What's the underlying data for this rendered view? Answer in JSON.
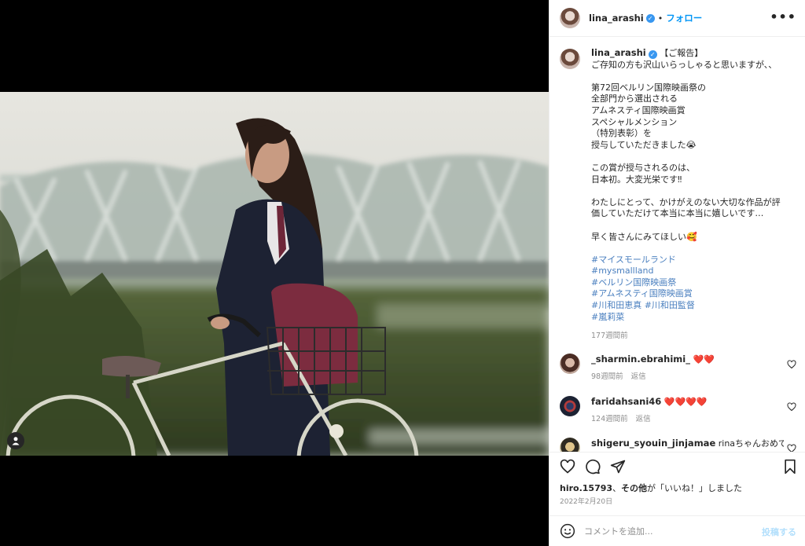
{
  "account": {
    "username": "lina_arashi",
    "verified": true,
    "follow_label": "フォロー"
  },
  "caption": {
    "lines": [
      "【ご報告】",
      "ご存知の方も沢山いらっしゃると思いますが、、",
      "",
      "第72回ベルリン国際映画祭の",
      "全部門から選出される",
      "アムネスティ国際映画賞",
      "スペシャルメンション",
      "（特別表彰）を",
      "授与していただきました😭",
      "",
      "この賞が授与されるのは、",
      "日本初。大変光栄です‼︎",
      "",
      "わたしにとって、かけがえのない大切な作品が評",
      "価していただけて本当に本当に嬉しいです…",
      "",
      "早く皆さんにみてほしい🥰",
      ""
    ],
    "hashtags": [
      [
        "#マイスモールランド"
      ],
      [
        "#mysmallland"
      ],
      [
        "#ベルリン国際映画祭"
      ],
      [
        "#アムネスティ国際映画賞"
      ],
      [
        "#川和田恵真",
        "#川和田監督"
      ],
      [
        "#嵐莉菜"
      ]
    ],
    "time": "177週間前"
  },
  "comments": [
    {
      "username": "_sharmin.ebrahimi_",
      "text": "❤️❤️",
      "time": "98週間前",
      "reply_label": "返信"
    },
    {
      "username": "faridahsani46",
      "text": "❤️❤️❤️❤️",
      "time": "124週間前",
      "reply_label": "返信"
    },
    {
      "username": "shigeru_syouin_jinjamae",
      "text": "rinaちゃんおめでと",
      "time": "",
      "reply_label": ""
    }
  ],
  "likes": {
    "user": "hiro.15793",
    "rest": "、その他が「いいね！」しました",
    "bold_rest": "その他"
  },
  "date": "2022年2月20日",
  "comment_box": {
    "placeholder": "コメントを追加...",
    "post_label": "投稿する"
  },
  "colors": {
    "link_blue": "#0095f6",
    "hashtag": "#4a7fbf",
    "verified_badge": "#3897f0",
    "muted": "#8e8e8e"
  },
  "icons": [
    "more-options-icon",
    "heart-icon",
    "comment-icon",
    "share-icon",
    "bookmark-icon",
    "emoji-icon",
    "tag-user-icon"
  ]
}
